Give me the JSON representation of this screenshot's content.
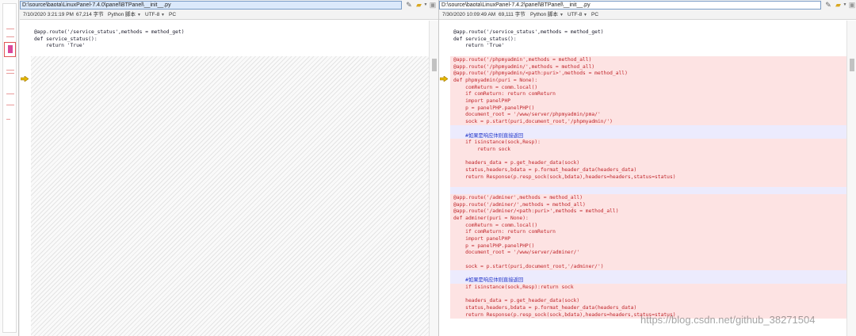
{
  "left_pane": {
    "path": "D:\\source\\baota\\LinuxPanel-7.4.0\\panel\\BTPanel\\__init__.py",
    "timestamp": "7/10/2020 3:21:19 PM",
    "size": "67,214 字节",
    "filetype": "Python 脚本",
    "encoding": "UTF-8",
    "lineending": "PC",
    "code": [
      {
        "text": "@app.route('/service_status',methods = method_get)",
        "kind": "normal"
      },
      {
        "text": "def service_status():",
        "kind": "normal"
      },
      {
        "text": "    return 'True'",
        "kind": "normal"
      }
    ]
  },
  "right_pane": {
    "path": "D:\\source\\baota\\LinuxPanel-7.4.2\\panel\\BTPanel\\__init__.py",
    "timestamp": "7/30/2020 10:09:49 AM",
    "size": "69,111 字节",
    "filetype": "Python 脚本",
    "encoding": "UTF-8",
    "lineending": "PC",
    "code": [
      {
        "text": "@app.route('/service_status',methods = method_get)",
        "kind": "normal"
      },
      {
        "text": "def service_status():",
        "kind": "normal"
      },
      {
        "text": "    return 'True'",
        "kind": "normal"
      },
      {
        "text": "",
        "kind": "normal"
      },
      {
        "text": "@app.route('/phpmyadmin',methods = method_all)",
        "kind": "chg"
      },
      {
        "text": "@app.route('/phpmyadmin/',methods = method_all)",
        "kind": "chg"
      },
      {
        "text": "@app.route('/phpmyadmin/<path:puri>',methods = method_all)",
        "kind": "chg"
      },
      {
        "text": "def phpmyadmin(puri = None):",
        "kind": "chg"
      },
      {
        "text": "    comReturn = comm.local()",
        "kind": "chg"
      },
      {
        "text": "    if comReturn: return comReturn",
        "kind": "chg"
      },
      {
        "text": "    import panelPHP",
        "kind": "chg"
      },
      {
        "text": "    p = panelPHP.panelPHP()",
        "kind": "chg"
      },
      {
        "text": "    document_root = '/www/server/phpmyadmin/pma/'",
        "kind": "chg"
      },
      {
        "text": "    sock = p.start(puri,document_root,'/phpmyadmin/')",
        "kind": "chg"
      },
      {
        "text": "",
        "kind": "cmt"
      },
      {
        "text": "    #如果是响应体则直接返回",
        "kind": "cmt"
      },
      {
        "text": "    if isinstance(sock,Resp):",
        "kind": "chg"
      },
      {
        "text": "        return sock",
        "kind": "chg"
      },
      {
        "text": "",
        "kind": "chg"
      },
      {
        "text": "    headers_data = p.get_header_data(sock)",
        "kind": "chg"
      },
      {
        "text": "    status,headers,bdata = p.format_header_data(headers_data)",
        "kind": "chg"
      },
      {
        "text": "    return Response(p.resp_sock(sock,bdata),headers=headers,status=status)",
        "kind": "chg"
      },
      {
        "text": "",
        "kind": "chg"
      },
      {
        "text": "",
        "kind": "cmt"
      },
      {
        "text": "@app.route('/adminer',methods = method_all)",
        "kind": "chg"
      },
      {
        "text": "@app.route('/adminer/',methods = method_all)",
        "kind": "chg"
      },
      {
        "text": "@app.route('/adminer/<path:puri>',methods = method_all)",
        "kind": "chg"
      },
      {
        "text": "def adminer(puri = None):",
        "kind": "chg"
      },
      {
        "text": "    comReturn = comm.local()",
        "kind": "chg"
      },
      {
        "text": "    if comReturn: return comReturn",
        "kind": "chg"
      },
      {
        "text": "    import panelPHP",
        "kind": "chg"
      },
      {
        "text": "    p = panelPHP.panelPHP()",
        "kind": "chg"
      },
      {
        "text": "    document_root = '/www/server/adminer/'",
        "kind": "chg"
      },
      {
        "text": "",
        "kind": "chg"
      },
      {
        "text": "    sock = p.start(puri,document_root,'/adminer/')",
        "kind": "chg"
      },
      {
        "text": "",
        "kind": "cmt"
      },
      {
        "text": "    #如果是响应体则直接返回",
        "kind": "cmt"
      },
      {
        "text": "    if isinstance(sock,Resp):return sock",
        "kind": "chg"
      },
      {
        "text": "",
        "kind": "chg"
      },
      {
        "text": "    headers_data = p.get_header_data(sock)",
        "kind": "chg"
      },
      {
        "text": "    status,headers,bdata = p.format_header_data(headers_data)",
        "kind": "chg"
      },
      {
        "text": "    return Response(p.resp_sock(sock,bdata),headers=headers,status=status)",
        "kind": "chg"
      }
    ]
  },
  "watermark": "https://blog.csdn.net/github_38271504",
  "colors": {
    "deleted_bg": "#fde3e3",
    "comment_bg": "#ecebfd",
    "changed_text": "#c0262b",
    "comment_text": "#2235c9"
  },
  "icons": [
    "edit-icon",
    "folder-open-icon",
    "save-icon",
    "chevron-down-icon",
    "diff-arrow-icon"
  ]
}
